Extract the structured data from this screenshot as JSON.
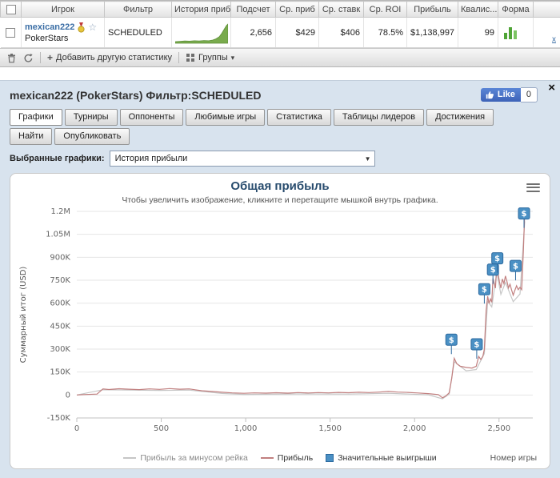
{
  "icons": {
    "star": "☆",
    "caret_down": "▾",
    "select_arrow": "▼",
    "close": "×",
    "plus": "+"
  },
  "table": {
    "headers": [
      "Игрок",
      "Фильтр",
      "История приб...",
      "Подсчет",
      "Ср. приб",
      "Ср. ставк",
      "Ср. ROI",
      "Прибыль",
      "Квалис...",
      "Форма"
    ],
    "row": {
      "player": "mexican222",
      "site": "PokerStars",
      "filter": "SCHEDULED",
      "count": "2,656",
      "avg_profit": "$429",
      "avg_stake": "$406",
      "avg_roi": "78.5%",
      "profit": "$1,138,997",
      "qualifies": "99",
      "remove_label": "х"
    },
    "toolbar": {
      "add_stat_label": "Добавить другую статистику",
      "groups_label": "Группы"
    }
  },
  "panel": {
    "title": "mexican222 (PokerStars) Фильтр:SCHEDULED",
    "like_label": "Like",
    "like_count": "0",
    "tabs": [
      "Графики",
      "Турниры",
      "Оппоненты",
      "Любимые игры",
      "Статистика",
      "Таблицы лидеров",
      "Достижения",
      "Найти"
    ],
    "tab_publish": "Опубликовать",
    "selected_graphs_label": "Выбранные графики:",
    "graph_select_value": "История прибыли"
  },
  "chart_data": {
    "type": "line",
    "title": "Общая прибыль",
    "subtitle": "Чтобы увеличить изображение, кликните и перетащите мышкой внутрь графика.",
    "ylabel": "Суммарный итог (USD)",
    "xlabel": "Номер игры",
    "xlim": [
      0,
      2700
    ],
    "ylim": [
      -150000,
      1200000
    ],
    "grid": true,
    "legend_position": "bottom",
    "y_ticks": [
      {
        "v": 1200000,
        "label": "1.2M"
      },
      {
        "v": 1050000,
        "label": "1.05M"
      },
      {
        "v": 900000,
        "label": "900K"
      },
      {
        "v": 750000,
        "label": "750K"
      },
      {
        "v": 600000,
        "label": "600K"
      },
      {
        "v": 450000,
        "label": "450K"
      },
      {
        "v": 300000,
        "label": "300K"
      },
      {
        "v": 150000,
        "label": "150K"
      },
      {
        "v": 0,
        "label": "0"
      },
      {
        "v": -150000,
        "label": "-150K"
      }
    ],
    "x_ticks": [
      {
        "v": 0,
        "label": "0"
      },
      {
        "v": 500,
        "label": "500"
      },
      {
        "v": 1000,
        "label": "1,000"
      },
      {
        "v": 1500,
        "label": "1,500"
      },
      {
        "v": 2000,
        "label": "2,000"
      },
      {
        "v": 2500,
        "label": "2,500"
      }
    ],
    "series": [
      {
        "name": "Прибыль за минусом рейка",
        "color": "#c6c6c6",
        "points": [
          [
            0,
            0
          ],
          [
            155,
            34000
          ],
          [
            310,
            32000
          ],
          [
            490,
            30000
          ],
          [
            665,
            32000
          ],
          [
            860,
            10000
          ],
          [
            990,
            4000
          ],
          [
            1310,
            7000
          ],
          [
            1610,
            6000
          ],
          [
            1845,
            11000
          ],
          [
            2080,
            1000
          ],
          [
            2165,
            -25000
          ],
          [
            2205,
            6000
          ],
          [
            2235,
            218000
          ],
          [
            2305,
            158000
          ],
          [
            2365,
            166000
          ],
          [
            2413,
            270000
          ],
          [
            2433,
            612000
          ],
          [
            2457,
            576000
          ],
          [
            2487,
            802000
          ],
          [
            2511,
            658000
          ],
          [
            2538,
            736000
          ],
          [
            2584,
            610000
          ],
          [
            2624,
            660000
          ],
          [
            2652,
            1135000
          ]
        ]
      },
      {
        "name": "Прибыль",
        "color": "#c17f7f",
        "points": [
          [
            0,
            0
          ],
          [
            40,
            3000
          ],
          [
            120,
            6000
          ],
          [
            155,
            40000
          ],
          [
            190,
            36000
          ],
          [
            250,
            41000
          ],
          [
            310,
            38000
          ],
          [
            370,
            35000
          ],
          [
            430,
            40000
          ],
          [
            490,
            37000
          ],
          [
            550,
            42000
          ],
          [
            610,
            38000
          ],
          [
            665,
            40000
          ],
          [
            700,
            34000
          ],
          [
            740,
            28000
          ],
          [
            800,
            23000
          ],
          [
            860,
            18000
          ],
          [
            920,
            14000
          ],
          [
            990,
            11000
          ],
          [
            1050,
            14000
          ],
          [
            1120,
            12000
          ],
          [
            1180,
            15000
          ],
          [
            1250,
            12000
          ],
          [
            1310,
            16000
          ],
          [
            1370,
            13000
          ],
          [
            1430,
            16000
          ],
          [
            1490,
            14000
          ],
          [
            1550,
            17000
          ],
          [
            1610,
            15000
          ],
          [
            1670,
            18000
          ],
          [
            1730,
            16000
          ],
          [
            1790,
            19000
          ],
          [
            1845,
            23000
          ],
          [
            1900,
            19000
          ],
          [
            1960,
            17000
          ],
          [
            2020,
            13000
          ],
          [
            2080,
            9000
          ],
          [
            2140,
            3000
          ],
          [
            2165,
            -18000
          ],
          [
            2185,
            -6000
          ],
          [
            2205,
            15000
          ],
          [
            2220,
            110000
          ],
          [
            2235,
            240000
          ],
          [
            2250,
            205000
          ],
          [
            2270,
            188000
          ],
          [
            2305,
            180000
          ],
          [
            2340,
            176000
          ],
          [
            2365,
            188000
          ],
          [
            2380,
            252000
          ],
          [
            2392,
            232000
          ],
          [
            2404,
            252000
          ],
          [
            2413,
            298000
          ],
          [
            2424,
            555000
          ],
          [
            2433,
            645000
          ],
          [
            2441,
            598000
          ],
          [
            2449,
            628000
          ],
          [
            2457,
            606000
          ],
          [
            2464,
            762000
          ],
          [
            2471,
            728000
          ],
          [
            2479,
            698000
          ],
          [
            2487,
            845000
          ],
          [
            2494,
            798000
          ],
          [
            2502,
            742000
          ],
          [
            2511,
            698000
          ],
          [
            2520,
            758000
          ],
          [
            2529,
            728000
          ],
          [
            2538,
            778000
          ],
          [
            2547,
            742000
          ],
          [
            2556,
            700000
          ],
          [
            2565,
            724000
          ],
          [
            2574,
            688000
          ],
          [
            2584,
            652000
          ],
          [
            2594,
            684000
          ],
          [
            2604,
            714000
          ],
          [
            2614,
            688000
          ],
          [
            2624,
            704000
          ],
          [
            2634,
            688000
          ],
          [
            2644,
            940000
          ],
          [
            2652,
            1190000
          ]
        ]
      }
    ],
    "markers": {
      "name": "Значительные выигрыши",
      "fill": "#4a90c4",
      "border": "#2d6a9f",
      "text_color": "#ffffff",
      "symbol": "$",
      "points": [
        [
          2218,
          330000
        ],
        [
          2368,
          300000
        ],
        [
          2413,
          660000
        ],
        [
          2464,
          788000
        ],
        [
          2490,
          862000
        ],
        [
          2598,
          812000
        ],
        [
          2648,
          1155000
        ]
      ]
    },
    "sparkline_history": [
      1,
      1,
      2,
      2,
      2,
      3,
      3,
      4,
      6,
      10,
      16,
      24
    ],
    "form_bars": [
      8,
      16,
      11
    ]
  }
}
